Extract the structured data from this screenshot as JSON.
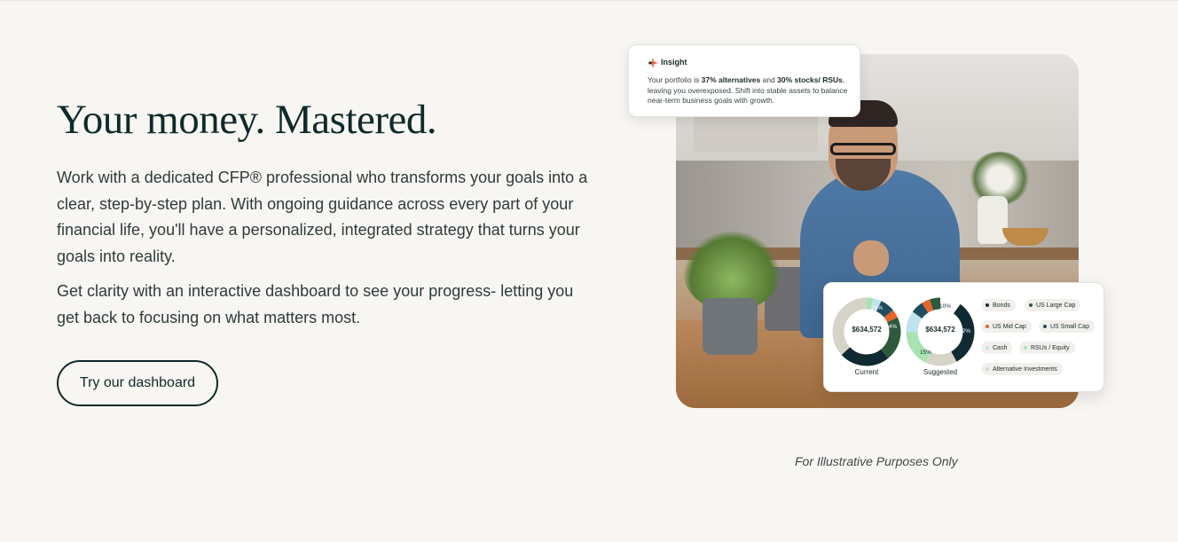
{
  "hero": {
    "headline": "Your money. Mastered.",
    "paragraph_1": "Work with a dedicated CFP® professional who transforms your goals into a clear, step-by-step plan. With ongoing guidance across every part of your financial life, you'll have a personalized, integrated strategy that turns your goals into reality.",
    "paragraph_2": "Get clarity with an interactive dashboard to see your progress- letting you get back to focusing on what matters most.",
    "cta_label": "Try our dashboard"
  },
  "insight_card": {
    "title": "Insight",
    "icon": "sparkle-icon",
    "body_prefix": "Your portfolio is ",
    "body_bold_1": "37% alternatives",
    "body_mid": " and ",
    "body_bold_2": "30% stocks/ RSUs",
    "body_suffix": ", leaving you overexposed. Shift into stable assets to balance near-term business goals with growth."
  },
  "dashboard_card": {
    "current": {
      "label": "Current",
      "total": "$634,572",
      "pct_labels": [
        "21%",
        "24%",
        "37%"
      ]
    },
    "suggested": {
      "label": "Suggested",
      "total": "$634,572",
      "pct_labels": [
        "10%",
        "32%",
        "15%"
      ]
    },
    "legend": [
      {
        "label": "Bonds",
        "color": "#0f2a33"
      },
      {
        "label": "US Large Cap",
        "color": "#2d5a3d"
      },
      {
        "label": "US Mid Cap",
        "color": "#e8622c"
      },
      {
        "label": "US Small Cap",
        "color": "#1e4d5c"
      },
      {
        "label": "Cash",
        "color": "#bfe3ef"
      },
      {
        "label": "RSUs / Equity",
        "color": "#a9e3b4"
      },
      {
        "label": "Alternative Investments",
        "color": "#d6d3c9"
      }
    ]
  },
  "caption": "For Illustrative Purposes Only",
  "colors": {
    "background": "#f8f6f2",
    "text": "#0f2a2b",
    "accent": "#e8622c"
  }
}
